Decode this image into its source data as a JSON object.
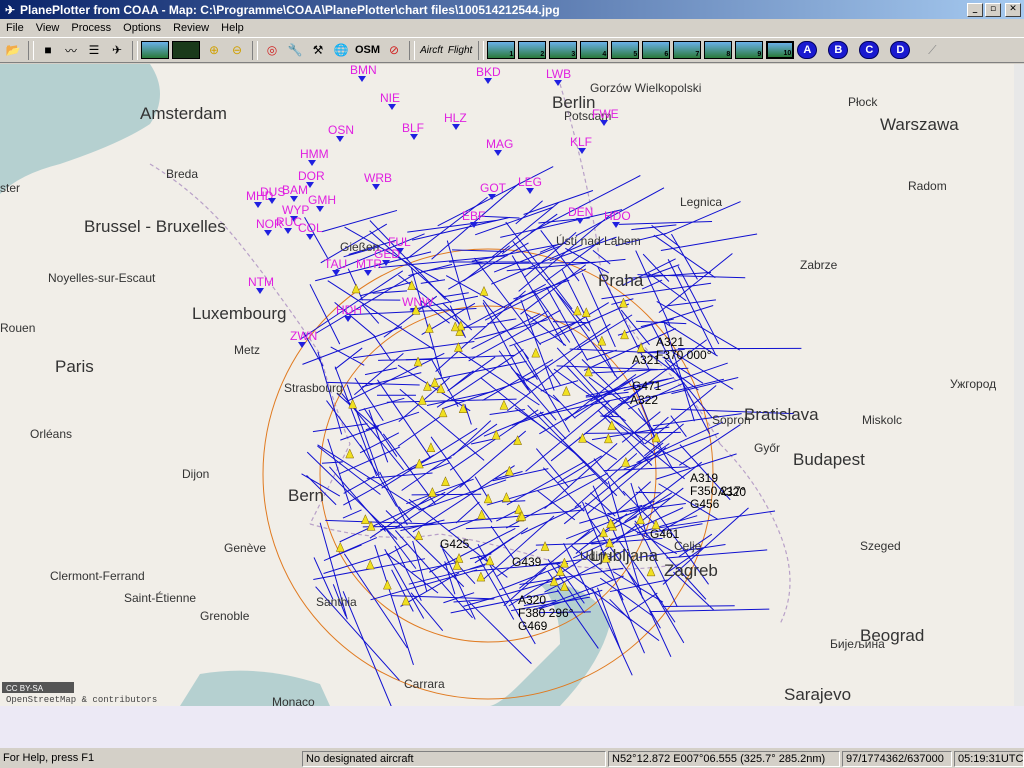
{
  "window": {
    "title": "PlanePlotter from COAA - Map: C:\\Programme\\COAA\\PlanePlotter\\chart files\\100514212544.jpg",
    "minimize_glyph": "_",
    "maximize_glyph": "▫",
    "close_glyph": "✕"
  },
  "menu": [
    "File",
    "View",
    "Process",
    "Options",
    "Review",
    "Help"
  ],
  "toolbar": {
    "aircraft_label": "Aircft",
    "flight_label": "Flight",
    "osm_label": "OSM",
    "chart_buttons": [
      "1",
      "2",
      "3",
      "4",
      "5",
      "6",
      "7",
      "8",
      "9",
      "10"
    ],
    "active_chart": "10",
    "layer_buttons": [
      "A",
      "B",
      "C",
      "D"
    ]
  },
  "map": {
    "range_ring_color": "#e07a20",
    "track_color": "#1010d0",
    "waypoint_color": "#e020e0",
    "cities": [
      {
        "name": "Amsterdam",
        "size": "big"
      },
      {
        "name": "Berlin",
        "size": "big"
      },
      {
        "name": "Warszawa",
        "size": "big"
      },
      {
        "name": "Brussel - Bruxelles",
        "size": "big"
      },
      {
        "name": "Luxembourg",
        "size": "big"
      },
      {
        "name": "Paris",
        "size": "big"
      },
      {
        "name": "Praha",
        "size": "big"
      },
      {
        "name": "Bratislava",
        "size": "big"
      },
      {
        "name": "Budapest",
        "size": "big"
      },
      {
        "name": "Bern",
        "size": "big"
      },
      {
        "name": "Ljubljana",
        "size": "big"
      },
      {
        "name": "Zagreb",
        "size": "big"
      },
      {
        "name": "Beograd",
        "size": "big"
      },
      {
        "name": "Sarajevo",
        "size": "big"
      },
      {
        "name": "Gorzów Wielkopolski",
        "size": "small"
      },
      {
        "name": "Płock",
        "size": "small"
      },
      {
        "name": "Radom",
        "size": "small"
      },
      {
        "name": "Breda",
        "size": "small"
      },
      {
        "name": "Legnica",
        "size": "small"
      },
      {
        "name": "Zabrze",
        "size": "small"
      },
      {
        "name": "Ústí nad Labem",
        "size": "small"
      },
      {
        "name": "Gießen",
        "size": "small"
      },
      {
        "name": "Noyelles-sur-Escaut",
        "size": "small"
      },
      {
        "name": "Rouen",
        "size": "small"
      },
      {
        "name": "Metz",
        "size": "small"
      },
      {
        "name": "Strasbourg",
        "size": "small"
      },
      {
        "name": "Orléans",
        "size": "small"
      },
      {
        "name": "Dijon",
        "size": "small"
      },
      {
        "name": "Genève",
        "size": "small"
      },
      {
        "name": "Clermont-Ferrand",
        "size": "small"
      },
      {
        "name": "Saint-Étienne",
        "size": "small"
      },
      {
        "name": "Santhia",
        "size": "small"
      },
      {
        "name": "Carrara",
        "size": "small"
      },
      {
        "name": "Monaco",
        "size": "small"
      },
      {
        "name": "Udine",
        "size": "small"
      },
      {
        "name": "Celje",
        "size": "small"
      },
      {
        "name": "Szeged",
        "size": "small"
      },
      {
        "name": "Miskolc",
        "size": "small"
      },
      {
        "name": "Győr",
        "size": "small"
      },
      {
        "name": "Sopron",
        "size": "small"
      },
      {
        "name": "Ужгород",
        "size": "small"
      },
      {
        "name": "Бијељина",
        "size": "small"
      },
      {
        "name": "Potsdam",
        "size": "small"
      },
      {
        "name": "Grenoble",
        "size": "small"
      },
      {
        "name": "ster",
        "size": "small"
      }
    ],
    "waypoints": [
      "BMN",
      "BKD",
      "LWB",
      "NIE",
      "HLZ",
      "FWE",
      "OSN",
      "BLF",
      "MAG",
      "KLF",
      "HMM",
      "DOR",
      "WRB",
      "GOT",
      "LEG",
      "MHD",
      "DUS",
      "BAM",
      "GMH",
      "WYP",
      "DEN",
      "HDO",
      "NOR",
      "RUC",
      "COL",
      "EBF",
      "FUL",
      "GED",
      "TAU",
      "MTR",
      "NTM",
      "ZWN",
      "WNW",
      "HDH"
    ],
    "aircraft_labels": [
      {
        "line1": "A321",
        "line2": "F370 000°",
        "line3": ""
      },
      {
        "line1": "A319",
        "line2": "F350 217°",
        "line3": "G456"
      },
      {
        "line1": "A320",
        "line2": "",
        "line3": ""
      },
      {
        "line1": "A320",
        "line2": "F380 296°",
        "line3": "G469"
      },
      {
        "line1": "A321",
        "line2": "",
        "line3": "G471"
      },
      {
        "line1": "A322",
        "line2": "",
        "line3": ""
      },
      {
        "line1": "",
        "line2": "",
        "line3": "G425"
      },
      {
        "line1": "",
        "line2": "",
        "line3": "G439"
      },
      {
        "line1": "",
        "line2": "",
        "line3": "G461"
      }
    ],
    "credit_badge": "CC BY-SA",
    "credit_text": "OpenStreetMap & contributors"
  },
  "status": {
    "help": "For Help, press F1",
    "designated": "No designated aircraft",
    "position": "N52°12.872 E007°06.555 (325.7° 285.2nm)",
    "counts": "97/1774362/637000",
    "time": "05:19:31UTC"
  }
}
